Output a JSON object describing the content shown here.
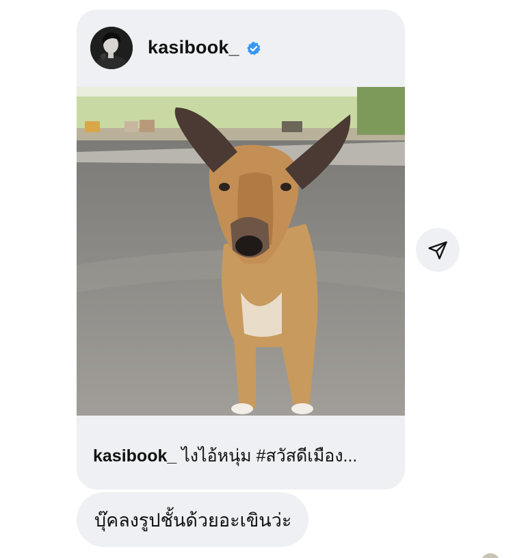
{
  "shared_post": {
    "username": "kasibook_",
    "verified": true,
    "caption_username": "kasibook_",
    "caption_text": " ไงไอ้หนุ่ม #สวัสดีเมือง...",
    "image_icon": "dog-photo"
  },
  "actions": {
    "share_icon": "send-icon"
  },
  "message": {
    "text": "บุ๊คลงรูปชั้นด้วยอะเขินว่ะ"
  },
  "colors": {
    "bubble_bg": "#eff0f3",
    "verified_blue": "#3897f0",
    "text": "#111111"
  }
}
